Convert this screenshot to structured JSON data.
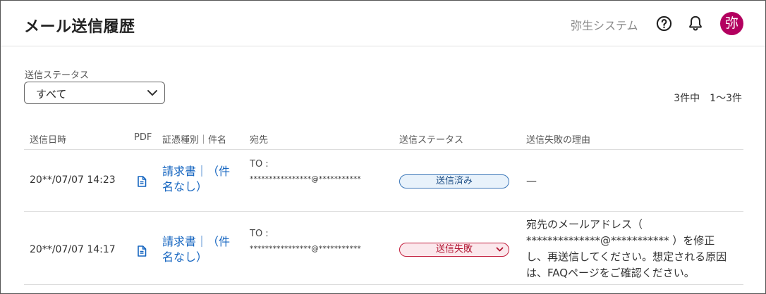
{
  "header": {
    "title": "メール送信履歴",
    "company": "弥生システム",
    "avatar_text": "弥"
  },
  "filter": {
    "label": "送信ステータス",
    "selected": "すべて"
  },
  "count_text": "3件中　1〜3件",
  "table": {
    "columns": [
      "送信日時",
      "PDF",
      "証憑種別｜件名",
      "宛先",
      "送信ステータス",
      "送信失敗の理由"
    ],
    "rows": [
      {
        "date": "20**/07/07 14:23",
        "doc": "請求書｜（件名なし）",
        "to_label": "TO :",
        "to_address": "****************@***********",
        "status": "送信済み",
        "reason": "—"
      },
      {
        "date": "20**/07/07 14:17",
        "doc": "請求書｜（件名なし）",
        "to_label": "TO :",
        "to_address": "****************@***********",
        "status": "送信失敗",
        "reason": "宛先のメールアドレス（ **************@*********** ）を修正し、再送信してください。想定される原因は、FAQページをご確認ください。"
      }
    ]
  },
  "colors": {
    "accent": "#1565c0",
    "avatar": "#b3005f",
    "status_ok": "#3a76b8",
    "status_fail": "#c21d3c"
  }
}
